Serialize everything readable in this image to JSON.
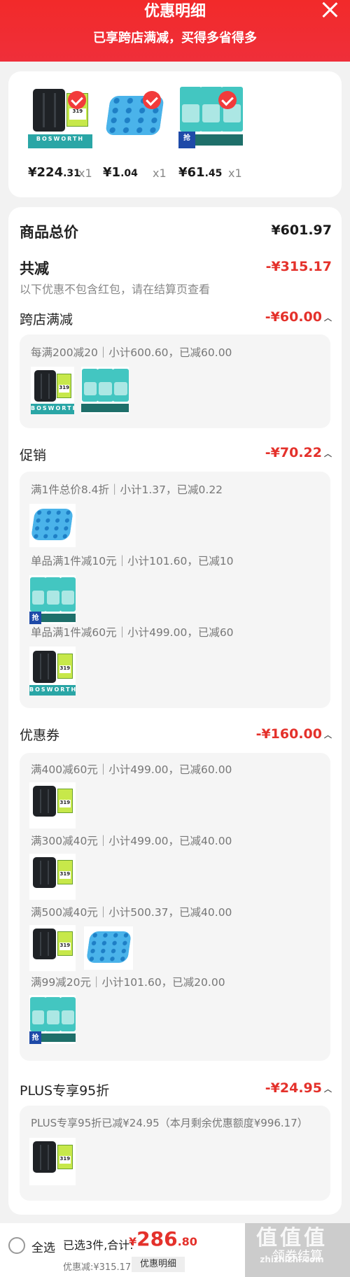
{
  "header": {
    "title": "优惠明细",
    "subtitle": "已享跨店满减，买得多省得多"
  },
  "products": [
    {
      "image": "suitcase",
      "price_int": "¥224",
      "price_dec": ".31",
      "qty": "x1",
      "brand": "BOSWORTH",
      "tag_price": "319"
    },
    {
      "image": "ice-tray",
      "price_int": "¥1",
      "price_dec": ".04",
      "qty": "x1"
    },
    {
      "image": "detergent-bags",
      "price_int": "¥61",
      "price_dec": ".45",
      "qty": "x1",
      "badge": "抢"
    }
  ],
  "summary": {
    "total_label": "商品总价",
    "total_value": "¥601.97",
    "discount_label": "共减",
    "discount_value": "-¥315.17",
    "note": "以下优惠不包含红包，请在结算页查看"
  },
  "sections": {
    "cross_store": {
      "label": "跨店满减",
      "value": "-¥60.00",
      "rule": "每满200减20｜小计600.60，已减60.00"
    },
    "promo": {
      "label": "促销",
      "value": "-¥70.22",
      "rules": [
        "满1件总价8.4折｜小计1.37，已减0.22",
        "单品满1件减10元｜小计101.60，已减10",
        "单品满1件减60元｜小计499.00，已减60"
      ]
    },
    "coupon": {
      "label": "优惠券",
      "value": "-¥160.00",
      "rules": [
        "满400减60元｜小计499.00，已减60.00",
        "满300减40元｜小计499.00，已减40.00",
        "满500减40元｜小计500.37，已减40.00",
        "满99减20元｜小计101.60，已减20.00"
      ]
    },
    "plus": {
      "label": "PLUS专享95折",
      "value": "-¥24.95",
      "rule": "PLUS专享95折已减¥24.95（本月剩余优惠额度¥996.17）"
    }
  },
  "bottom": {
    "select_all": "全选",
    "selected": "已选3件,合计:",
    "total_sym": "¥",
    "total_int": "286",
    "total_dec": ".80",
    "saved": "优惠减:¥315.17",
    "detail_button": "优惠明细",
    "checkout": "领券结算",
    "watermark": "值值值",
    "watermark_url": "zhizhizhi.com"
  },
  "colors": {
    "header_red": "#f22a2a",
    "discount_red": "#e4312b",
    "check_red": "#f23b3b"
  }
}
